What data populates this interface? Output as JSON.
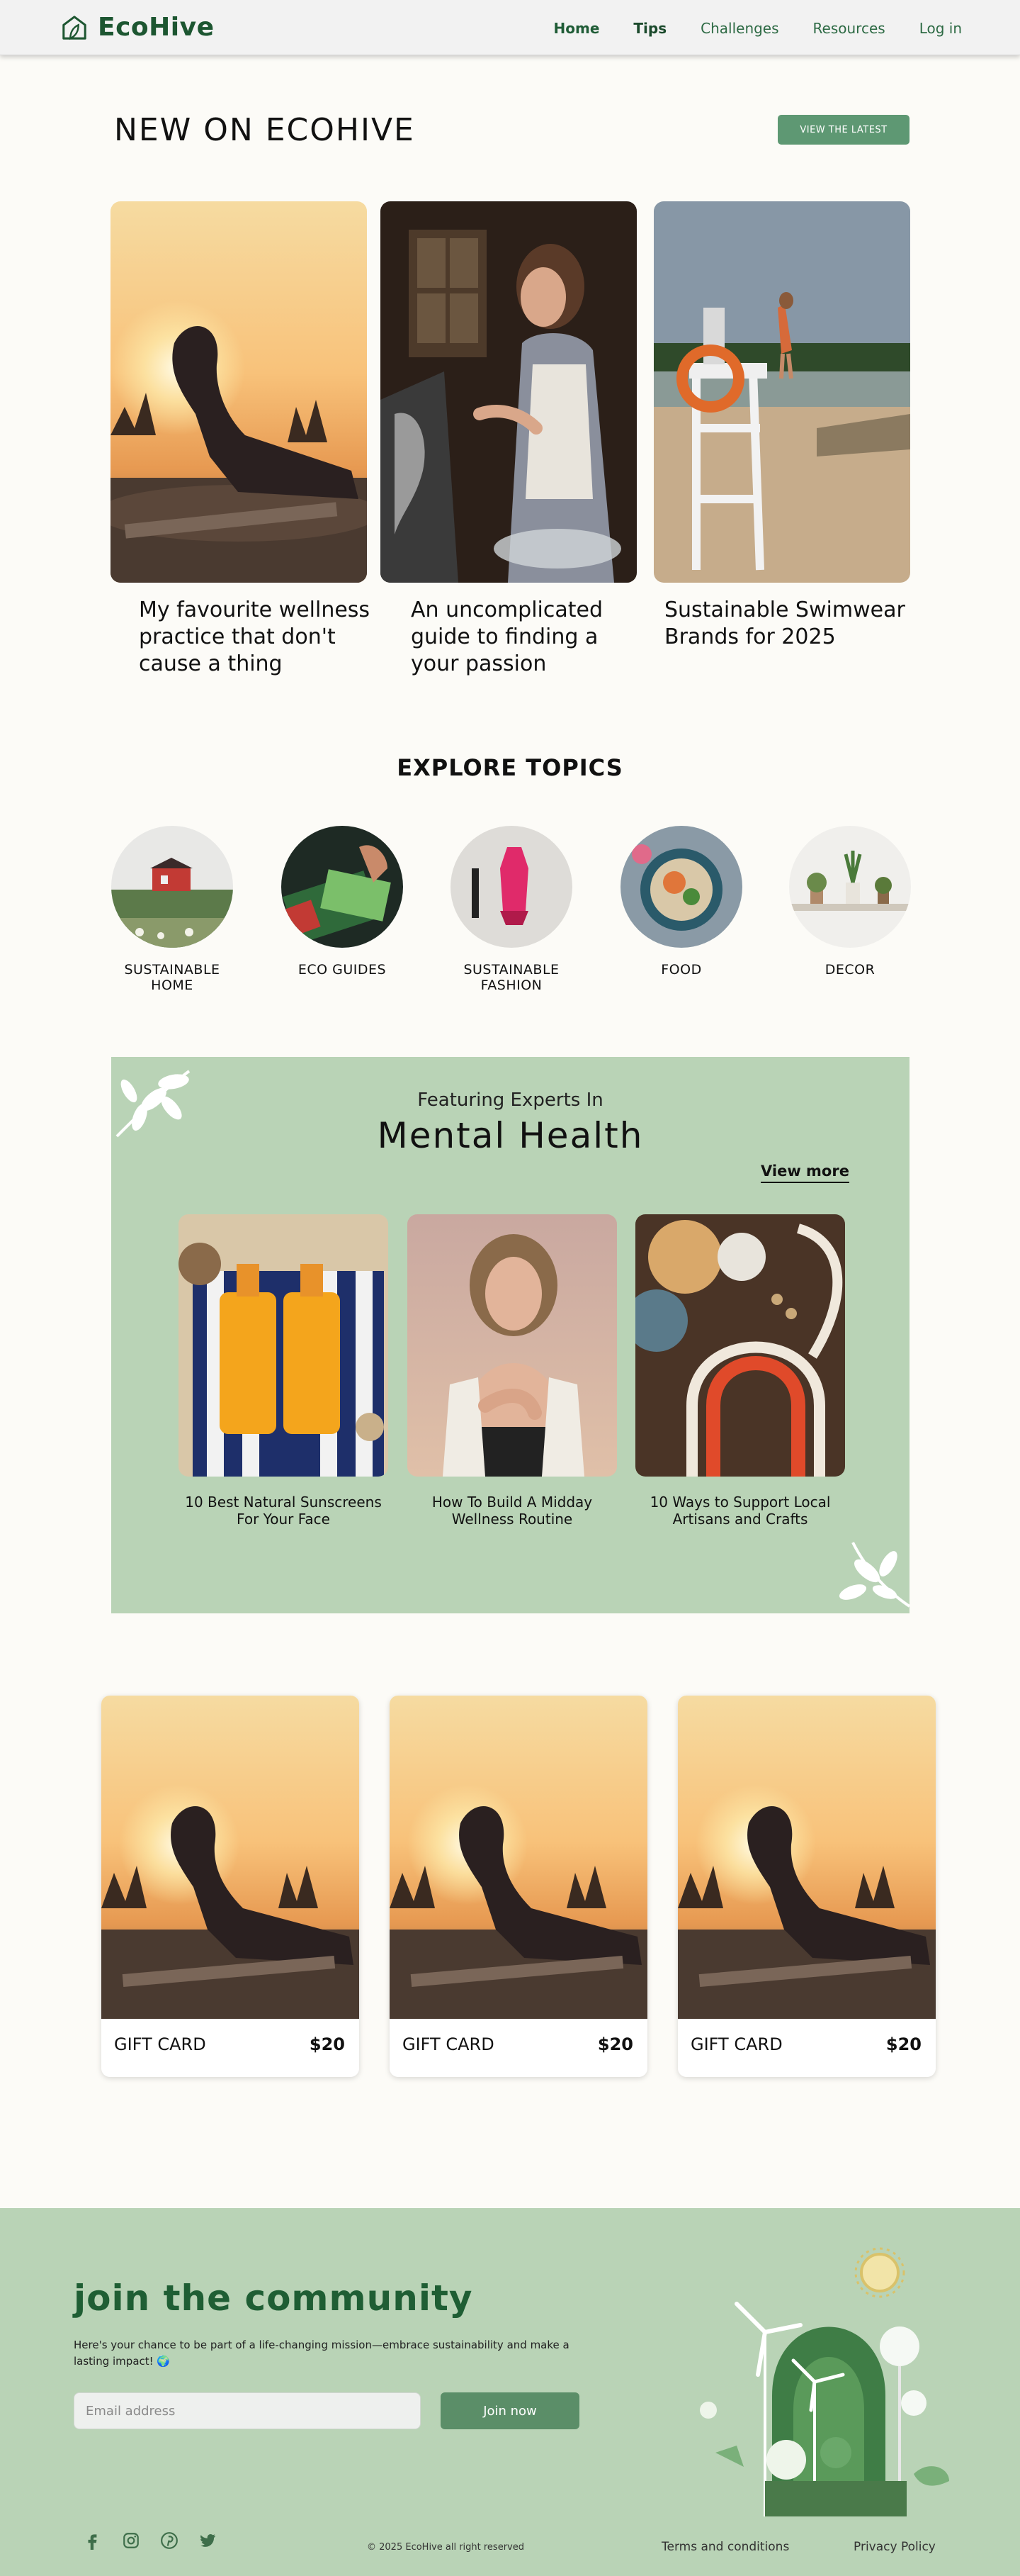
{
  "header": {
    "logo_text": "EcoHive",
    "nav": [
      {
        "label": "Home"
      },
      {
        "label": "Tips"
      },
      {
        "label": "Challenges"
      },
      {
        "label": "Resources"
      },
      {
        "label": "Log in"
      }
    ]
  },
  "new_section": {
    "title": "NEW ON ECOHIVE",
    "button_label": "VIEW THE LATEST",
    "posts": [
      {
        "title": "My favourite wellness practice that don't cause a thing",
        "image": "sunset-yoga-photo"
      },
      {
        "title": "An uncomplicated guide to finding a your passion",
        "image": "painting-woman-photo"
      },
      {
        "title": "Sustainable Swimwear Brands for 2025",
        "image": "lifeguard-tower-photo"
      }
    ]
  },
  "topics": {
    "title": "EXPLORE TOPICS",
    "items": [
      {
        "label": "SUSTAINABLE HOME"
      },
      {
        "label": "ECO GUIDES"
      },
      {
        "label": "SUSTAINABLE FASHION"
      },
      {
        "label": "FOOD"
      },
      {
        "label": "DECOR"
      }
    ]
  },
  "feature": {
    "subtitle": "Featuring Experts In",
    "title": "Mental Health",
    "view_more": "View more",
    "cards": [
      {
        "caption": "10 Best Natural Sunscreens For Your Face"
      },
      {
        "caption": "How To Build A Midday  Wellness Routine"
      },
      {
        "caption": "10 Ways to Support Local Artisans and Crafts"
      }
    ]
  },
  "gift_cards": [
    {
      "label": "GIFT CARD",
      "price": "$20"
    },
    {
      "label": "GIFT CARD",
      "price": "$20"
    },
    {
      "label": "GIFT CARD",
      "price": "$20"
    }
  ],
  "footer": {
    "join_title": "join the community",
    "join_text": "Here's your chance to be part of a life-changing mission—embrace sustainability and make a lasting impact! 🌍",
    "email_placeholder": "Email address",
    "join_button": "Join now",
    "socials": [
      "facebook-icon",
      "instagram-icon",
      "pinterest-icon",
      "twitter-icon"
    ],
    "copyright": "© 2025 EcoHive all right reserved",
    "terms": "Terms and conditions",
    "privacy": "Privacy Policy"
  },
  "colors": {
    "brand_green": "#1d5631",
    "button_green": "#5e9873",
    "feature_bg": "#b9d3b6",
    "page_bg": "#fcfbf7"
  }
}
